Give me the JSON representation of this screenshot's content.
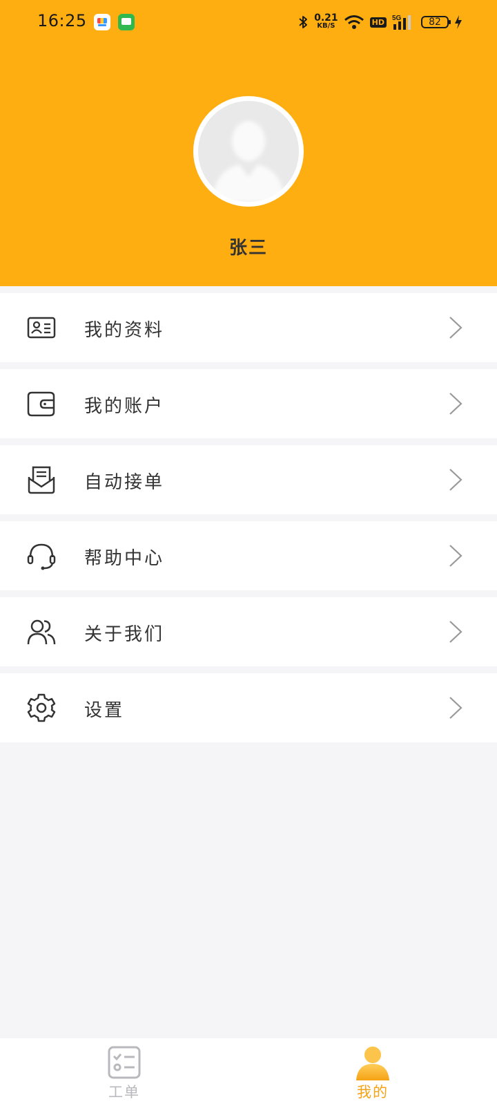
{
  "status_bar": {
    "time": "16:25",
    "net_speed_value": "0.21",
    "net_speed_unit": "KB/S",
    "hd_label": "HD",
    "network_label": "5G",
    "battery": "82"
  },
  "profile": {
    "username": "张三"
  },
  "menu": {
    "items": [
      {
        "label": "我的资料",
        "icon": "id-card-icon"
      },
      {
        "label": "我的账户",
        "icon": "wallet-icon"
      },
      {
        "label": "自动接单",
        "icon": "mail-order-icon"
      },
      {
        "label": "帮助中心",
        "icon": "headset-icon"
      },
      {
        "label": "关于我们",
        "icon": "users-icon"
      },
      {
        "label": "设置",
        "icon": "gear-icon"
      }
    ]
  },
  "tabbar": {
    "items": [
      {
        "label": "工单",
        "icon": "checklist-icon",
        "active": false
      },
      {
        "label": "我的",
        "icon": "person-icon",
        "active": true
      }
    ]
  },
  "colors": {
    "accent": "#ffae11",
    "tab_active": "#f5a214",
    "tab_inactive": "#b9b9bd",
    "background": "#f5f5f7"
  }
}
